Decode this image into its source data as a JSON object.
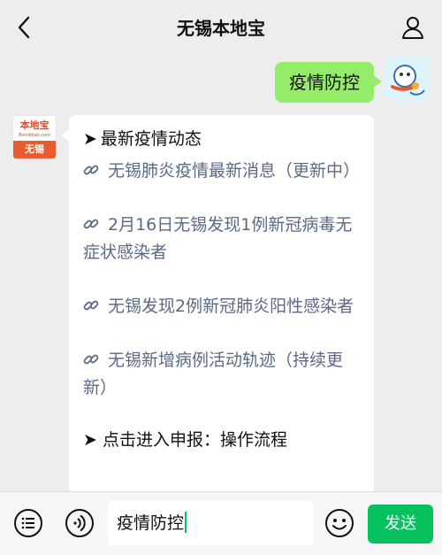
{
  "header": {
    "title": "无锡本地宝"
  },
  "messages": {
    "user_text": "疫情防控",
    "bot": {
      "avatar_name_cn": "本地宝",
      "avatar_name_en": "Bendibao.com",
      "avatar_city": "无锡",
      "heading_arrow": "➤",
      "heading": "最新疫情动态",
      "items": [
        "无锡肺炎疫情最新消息（更新中）",
        "2月16日无锡发现1例新冠病毒无症状感染者",
        "无锡发现2例新冠肺炎阳性感染者",
        "无锡新增病例活动轨迹（持续更新）"
      ],
      "cut_line": "➤ 点击进入申报：操作流程"
    }
  },
  "composer": {
    "input_value": "疫情防控",
    "send_label": "发送"
  },
  "colors": {
    "bg": "#ededed",
    "user_bubble": "#95ec69",
    "send_button": "#07c160",
    "link_text": "#5a6a86"
  },
  "icons": {
    "back": "chevron-left-icon",
    "profile": "person-icon",
    "menu": "list-icon",
    "voice": "voice-icon",
    "emoji": "emoji-icon",
    "link": "link-icon"
  }
}
